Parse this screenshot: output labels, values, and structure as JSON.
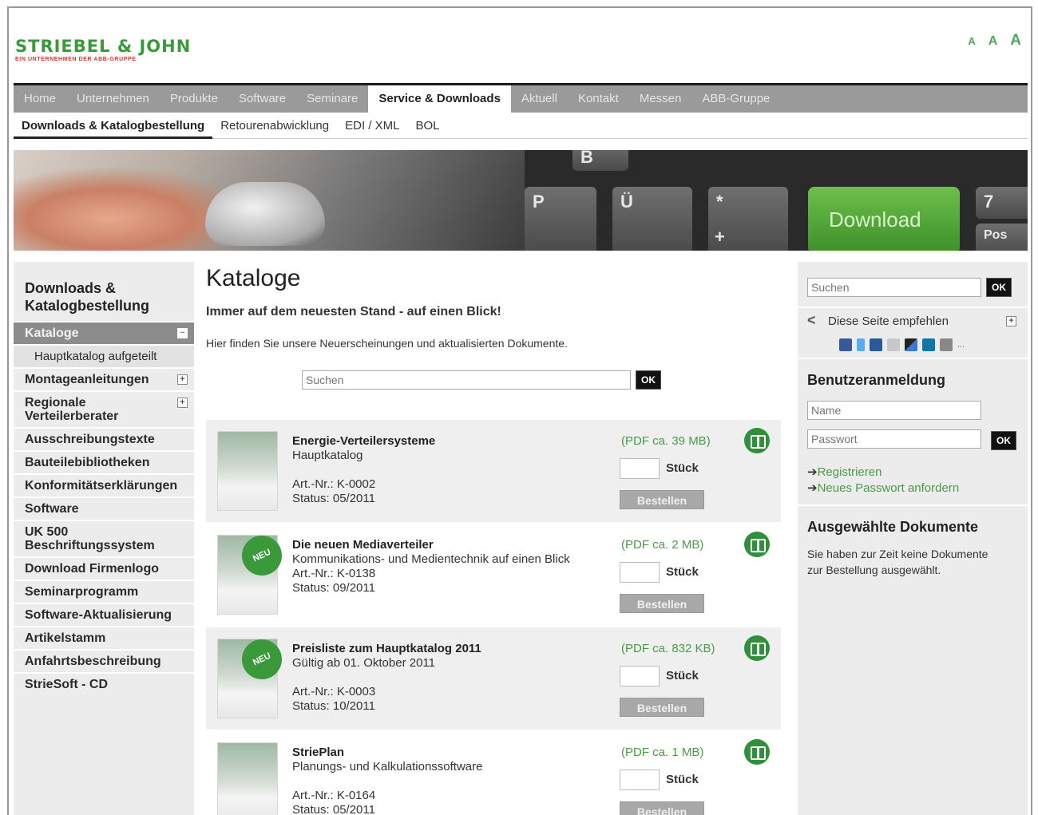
{
  "header": {
    "brand": "STRIEBEL & JOHN",
    "tagline": "EIN UNTERNEHMEN DER ABB-GRUPPE",
    "font_sizes": [
      "A",
      "A",
      "A"
    ]
  },
  "main_nav": [
    {
      "label": "Home",
      "active": false
    },
    {
      "label": "Unternehmen",
      "active": false
    },
    {
      "label": "Produkte",
      "active": false
    },
    {
      "label": "Software",
      "active": false
    },
    {
      "label": "Seminare",
      "active": false
    },
    {
      "label": "Service & Downloads",
      "active": true
    },
    {
      "label": "Aktuell",
      "active": false
    },
    {
      "label": "Kontakt",
      "active": false
    },
    {
      "label": "Messen",
      "active": false
    },
    {
      "label": "ABB-Gruppe",
      "active": false
    }
  ],
  "sub_nav": [
    {
      "label": "Downloads & Katalogbestellung",
      "active": true
    },
    {
      "label": "Retourenabwicklung",
      "active": false
    },
    {
      "label": "EDI / XML",
      "active": false
    },
    {
      "label": "BOL",
      "active": false
    }
  ],
  "hero": {
    "keys": [
      "B",
      "P",
      "Ü",
      "*",
      "+",
      "7",
      "Pos"
    ],
    "download_key": "Download"
  },
  "sidebar": {
    "title": "Downloads & Katalogbestellung",
    "items": [
      {
        "label": "Kataloge",
        "active": true,
        "toggle": "−"
      },
      {
        "label": "Hauptkatalog aufgeteilt",
        "sub": true
      },
      {
        "label": "Montageanleitungen",
        "toggle": "+"
      },
      {
        "label": "Regionale Verteilerberater",
        "toggle": "+"
      },
      {
        "label": "Ausschreibungstexte"
      },
      {
        "label": "Bauteilebibliotheken"
      },
      {
        "label": "Konformitätserklärungen"
      },
      {
        "label": "Software"
      },
      {
        "label": "UK 500 Beschriftungssystem"
      },
      {
        "label": "Download Firmenlogo"
      },
      {
        "label": "Seminarprogramm"
      },
      {
        "label": "Software-Aktualisierung"
      },
      {
        "label": "Artikelstamm"
      },
      {
        "label": "Anfahrtsbeschreibung"
      },
      {
        "label": "StrieSoft - CD"
      }
    ]
  },
  "content": {
    "title": "Kataloge",
    "lead": "Immer auf dem neuesten Stand - auf einen Blick!",
    "intro": "Hier finden Sie unsere Neuerscheinungen und aktualisierten Dokumente.",
    "search_placeholder": "Suchen",
    "ok_label": "OK"
  },
  "products": [
    {
      "name": "Energie-Verteilersysteme",
      "subtitle": "Hauptkatalog",
      "art": "Art.-Nr.: K-0002",
      "status": "Status: 05/2011",
      "pdf": "(PDF ca. 39 MB)",
      "qty_label": "Stück",
      "order_label": "Bestellen",
      "new": false,
      "shade": true
    },
    {
      "name": "Die neuen Mediaverteiler",
      "subtitle": "Kommunikations- und Medientechnik auf einen Blick",
      "art": "Art.-Nr.: K-0138",
      "status": "Status: 09/2011",
      "pdf": "(PDF ca. 2 MB)",
      "qty_label": "Stück",
      "order_label": "Bestellen",
      "new": true,
      "new_label": "NEU",
      "shade": false
    },
    {
      "name": "Preisliste zum Hauptkatalog 2011",
      "subtitle": "Gültig ab 01. Oktober 2011",
      "art": "Art.-Nr.: K-0003",
      "status": "Status: 10/2011",
      "pdf": "(PDF ca. 832 KB)",
      "qty_label": "Stück",
      "order_label": "Bestellen",
      "new": true,
      "new_label": "NEU",
      "shade": true
    },
    {
      "name": "StriePlan",
      "subtitle": "Planungs- und Kalkulationssoftware",
      "art": "Art.-Nr.: K-0164",
      "status": "Status: 05/2011",
      "pdf": "(PDF ca. 1 MB)",
      "qty_label": "Stück",
      "order_label": "Bestellen",
      "new": false,
      "shade": false
    }
  ],
  "right_sidebar": {
    "search_placeholder": "Suchen",
    "ok_label": "OK",
    "share_label": "Diese Seite empfehlen",
    "share_toggle": "+",
    "social_icons": [
      "facebook-icon",
      "twitter-icon",
      "share-icon",
      "bookmark-icon",
      "delicious-icon",
      "linkedin-icon",
      "print-icon"
    ],
    "social_more": "...",
    "login_title": "Benutzeranmeldung",
    "name_placeholder": "Name",
    "password_placeholder": "Passwort",
    "register_label": "Registrieren",
    "new_password_label": "Neues Passwort anfordern",
    "arrow": "➔",
    "docs_title": "Ausgewählte Dokumente",
    "docs_text": "Sie haben zur Zeit keine Dokumente zur Bestellung ausgewählt."
  },
  "colors": {
    "brand_green": "#3a9a3a",
    "link_green": "#4a9a4a",
    "nav_gray": "#9a9a9a",
    "sidebar_gray": "#ececec"
  }
}
